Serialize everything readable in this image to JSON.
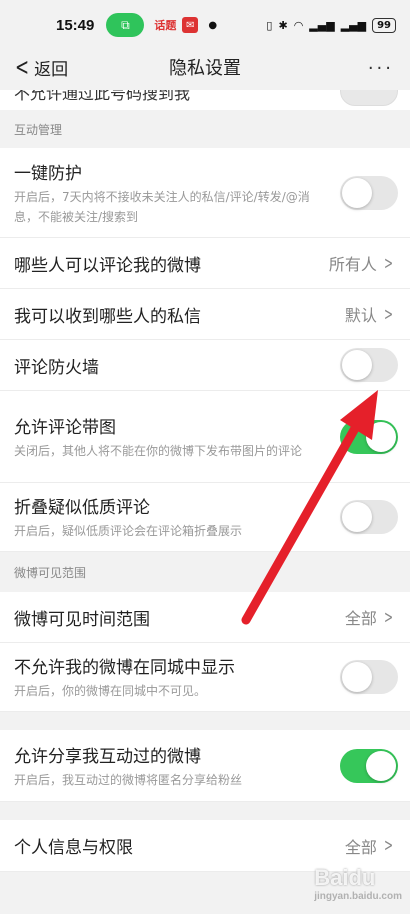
{
  "status_bar": {
    "time": "15:49",
    "app1": "话题",
    "battery": "99"
  },
  "nav": {
    "back_label": "返回",
    "title": "隐私设置",
    "more_label": "···"
  },
  "partial_top": {
    "label": "不允许通过此号码搜到我"
  },
  "sections": {
    "interaction": "互动管理",
    "visibility": "微博可见范围"
  },
  "rows": {
    "one_click": {
      "title": "一键防护",
      "sub": "开启后，7天内将不接收未关注人的私信/评论/转发/@消息，不能被关注/搜索到",
      "on": false
    },
    "who_comment": {
      "title": "哪些人可以评论我的微博",
      "value": "所有人"
    },
    "who_message": {
      "title": "我可以收到哪些人的私信",
      "value": "默认"
    },
    "firewall": {
      "title": "评论防火墙",
      "on": false
    },
    "comment_image": {
      "title": "允许评论带图",
      "sub": "关闭后，其他人将不能在你的微博下发布带图片的评论",
      "on": true
    },
    "fold_low": {
      "title": "折叠疑似低质评论",
      "sub": "开启后，疑似低质评论会在评论箱折叠展示",
      "on": false
    },
    "visible_time": {
      "title": "微博可见时间范围",
      "value": "全部"
    },
    "city_hide": {
      "title": "不允许我的微博在同城中显示",
      "sub": "开启后，你的微博在同城中不可见。",
      "on": false
    },
    "share_interact": {
      "title": "允许分享我互动过的微博",
      "sub": "开启后，我互动过的微博将匿名分享给粉丝",
      "on": true
    },
    "personal_info": {
      "title": "个人信息与权限",
      "value": "全部"
    }
  },
  "colors": {
    "toggle_on": "#36c75a",
    "arrow": "#e5202a"
  },
  "watermark": {
    "text": "Baidu",
    "sub": "jingyan.baidu.com"
  }
}
